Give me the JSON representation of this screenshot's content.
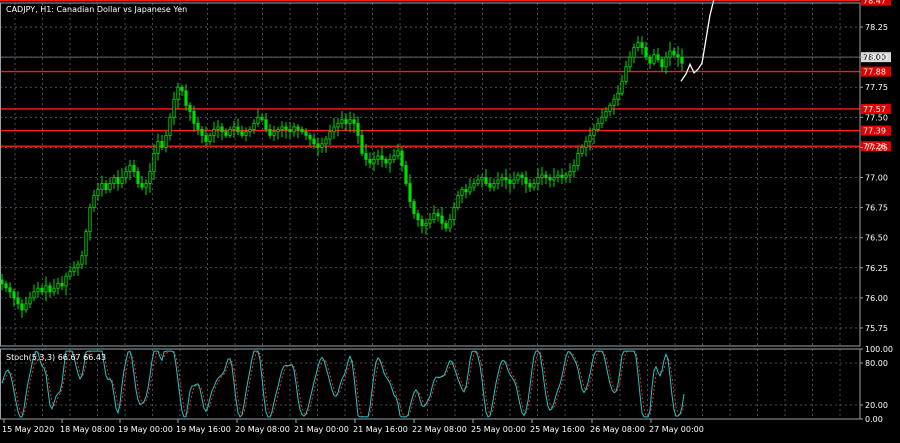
{
  "header": {
    "title": "CADJPY, H1:  Canadian Dollar vs Japanese Yen"
  },
  "indicator": {
    "label": "Stoch(5,3,3) 66.67 66.43"
  },
  "colors": {
    "background": "#000000",
    "grid": "#5a6470",
    "frame": "#9aa3ad",
    "axis_text": "#ffffff",
    "candle": "#00dd00",
    "level_line": "#ff1a1a",
    "level_label_bg": "#e00000",
    "price_label_bg": "#d8d8d8",
    "forecast": "#ffffff",
    "stoch_main": "#22c7c7",
    "stoch_signal": "#ff3030"
  },
  "chart_data": {
    "type": "candlestick",
    "symbol": "CADJPY",
    "timeframe": "H1",
    "ylim": [
      75.6,
      78.45
    ],
    "y_ticks": [
      "78.25",
      "78.00",
      "77.75",
      "77.50",
      "77.25",
      "77.00",
      "76.75",
      "76.50",
      "76.25",
      "76.00",
      "75.75"
    ],
    "y_tick_values": [
      78.25,
      78.0,
      77.75,
      77.5,
      77.25,
      77.0,
      76.75,
      76.5,
      76.25,
      76.0,
      75.75
    ],
    "x_ticks": [
      "15 May 2020",
      "18 May 08:00",
      "19 May 00:00",
      "19 May 16:00",
      "20 May 08:00",
      "21 May 00:00",
      "21 May 16:00",
      "22 May 08:00",
      "25 May 00:00",
      "25 May 16:00",
      "26 May 08:00",
      "27 May 00:00"
    ],
    "current_price": {
      "label": "78.00",
      "value": 78.0
    },
    "levels": [
      {
        "label": "78.47",
        "value": 78.47
      },
      {
        "label": "77.88",
        "value": 77.88
      },
      {
        "label": "77.57",
        "value": 77.57
      },
      {
        "label": "77.39",
        "value": 77.39
      },
      {
        "label": "77.26",
        "value": 77.26
      }
    ],
    "price_path": [
      [
        0,
        76.15
      ],
      [
        6,
        76.1
      ],
      [
        12,
        76.05
      ],
      [
        16,
        76.0
      ],
      [
        20,
        75.95
      ],
      [
        24,
        75.9
      ],
      [
        28,
        75.95
      ],
      [
        32,
        76.0
      ],
      [
        36,
        76.05
      ],
      [
        40,
        76.08
      ],
      [
        44,
        76.05
      ],
      [
        48,
        76.1
      ],
      [
        52,
        76.05
      ],
      [
        56,
        76.08
      ],
      [
        60,
        76.12
      ],
      [
        64,
        76.1
      ],
      [
        68,
        76.18
      ],
      [
        72,
        76.22
      ],
      [
        76,
        76.25
      ],
      [
        80,
        76.28
      ],
      [
        84,
        76.35
      ],
      [
        88,
        76.55
      ],
      [
        92,
        76.75
      ],
      [
        96,
        76.85
      ],
      [
        100,
        76.9
      ],
      [
        104,
        76.95
      ],
      [
        108,
        76.9
      ],
      [
        112,
        76.95
      ],
      [
        116,
        77.0
      ],
      [
        120,
        76.95
      ],
      [
        124,
        77.0
      ],
      [
        128,
        77.05
      ],
      [
        132,
        77.1
      ],
      [
        136,
        77.05
      ],
      [
        140,
        76.95
      ],
      [
        144,
        76.92
      ],
      [
        148,
        76.95
      ],
      [
        152,
        77.05
      ],
      [
        156,
        77.2
      ],
      [
        160,
        77.3
      ],
      [
        164,
        77.25
      ],
      [
        168,
        77.35
      ],
      [
        172,
        77.5
      ],
      [
        176,
        77.65
      ],
      [
        180,
        77.75
      ],
      [
        184,
        77.72
      ],
      [
        188,
        77.6
      ],
      [
        192,
        77.55
      ],
      [
        196,
        77.45
      ],
      [
        200,
        77.4
      ],
      [
        204,
        77.35
      ],
      [
        208,
        77.3
      ],
      [
        212,
        77.35
      ],
      [
        216,
        77.4
      ],
      [
        220,
        77.42
      ],
      [
        224,
        77.38
      ],
      [
        228,
        77.35
      ],
      [
        232,
        77.4
      ],
      [
        236,
        77.42
      ],
      [
        240,
        77.38
      ],
      [
        244,
        77.35
      ],
      [
        248,
        77.38
      ],
      [
        252,
        77.4
      ],
      [
        256,
        77.45
      ],
      [
        260,
        77.5
      ],
      [
        264,
        77.48
      ],
      [
        268,
        77.4
      ],
      [
        272,
        77.35
      ],
      [
        276,
        77.38
      ],
      [
        280,
        77.4
      ],
      [
        284,
        77.42
      ],
      [
        288,
        77.4
      ],
      [
        292,
        77.38
      ],
      [
        296,
        77.42
      ],
      [
        300,
        77.4
      ],
      [
        304,
        77.38
      ],
      [
        308,
        77.35
      ],
      [
        312,
        77.32
      ],
      [
        316,
        77.28
      ],
      [
        320,
        77.25
      ],
      [
        324,
        77.28
      ],
      [
        328,
        77.32
      ],
      [
        332,
        77.38
      ],
      [
        336,
        77.42
      ],
      [
        340,
        77.45
      ],
      [
        344,
        77.48
      ],
      [
        348,
        77.45
      ],
      [
        352,
        77.48
      ],
      [
        356,
        77.45
      ],
      [
        360,
        77.35
      ],
      [
        364,
        77.2
      ],
      [
        368,
        77.15
      ],
      [
        372,
        77.12
      ],
      [
        376,
        77.15
      ],
      [
        380,
        77.18
      ],
      [
        384,
        77.15
      ],
      [
        388,
        77.12
      ],
      [
        392,
        77.15
      ],
      [
        396,
        77.18
      ],
      [
        400,
        77.22
      ],
      [
        404,
        77.1
      ],
      [
        408,
        76.95
      ],
      [
        412,
        76.8
      ],
      [
        416,
        76.7
      ],
      [
        420,
        76.65
      ],
      [
        424,
        76.6
      ],
      [
        428,
        76.62
      ],
      [
        432,
        76.65
      ],
      [
        436,
        76.7
      ],
      [
        440,
        76.68
      ],
      [
        444,
        76.62
      ],
      [
        448,
        76.58
      ],
      [
        452,
        76.65
      ],
      [
        456,
        76.75
      ],
      [
        460,
        76.85
      ],
      [
        464,
        76.9
      ],
      [
        468,
        76.88
      ],
      [
        472,
        76.92
      ],
      [
        476,
        76.95
      ],
      [
        480,
        76.98
      ],
      [
        484,
        77.0
      ],
      [
        488,
        76.95
      ],
      [
        492,
        76.92
      ],
      [
        496,
        76.95
      ],
      [
        500,
        76.98
      ],
      [
        504,
        77.0
      ],
      [
        508,
        76.98
      ],
      [
        512,
        76.95
      ],
      [
        516,
        76.98
      ],
      [
        520,
        77.02
      ],
      [
        524,
        77.0
      ],
      [
        528,
        76.95
      ],
      [
        532,
        76.92
      ],
      [
        536,
        76.95
      ],
      [
        540,
        77.0
      ],
      [
        544,
        77.02
      ],
      [
        548,
        77.0
      ],
      [
        552,
        76.98
      ],
      [
        556,
        77.0
      ],
      [
        560,
        77.02
      ],
      [
        564,
        77.0
      ],
      [
        568,
        77.02
      ],
      [
        572,
        77.05
      ],
      [
        576,
        77.1
      ],
      [
        580,
        77.2
      ],
      [
        584,
        77.25
      ],
      [
        588,
        77.3
      ],
      [
        592,
        77.35
      ],
      [
        596,
        77.4
      ],
      [
        600,
        77.45
      ],
      [
        604,
        77.5
      ],
      [
        608,
        77.55
      ],
      [
        612,
        77.6
      ],
      [
        616,
        77.65
      ],
      [
        620,
        77.7
      ],
      [
        624,
        77.8
      ],
      [
        628,
        77.92
      ],
      [
        632,
        78.0
      ],
      [
        636,
        78.08
      ],
      [
        640,
        78.12
      ],
      [
        644,
        78.08
      ],
      [
        648,
        78.0
      ],
      [
        652,
        77.95
      ],
      [
        656,
        78.02
      ],
      [
        660,
        77.98
      ],
      [
        664,
        77.92
      ],
      [
        668,
        78.0
      ],
      [
        672,
        78.05
      ],
      [
        676,
        78.02
      ],
      [
        680,
        78.0
      ],
      [
        684,
        77.95
      ]
    ],
    "forecast_path": [
      [
        681,
        77.8
      ],
      [
        686,
        77.86
      ],
      [
        690,
        77.94
      ],
      [
        694,
        77.87
      ],
      [
        698,
        77.9
      ],
      [
        702,
        77.95
      ],
      [
        706,
        78.15
      ],
      [
        710,
        78.35
      ],
      [
        716,
        78.55
      ]
    ],
    "stochastic": {
      "ylim": [
        0,
        100
      ],
      "y_ticks": [
        "100.00",
        "80.00",
        "20.00",
        "0.00"
      ],
      "y_tick_values": [
        100,
        80,
        20,
        0
      ],
      "period_length": 28
    }
  }
}
